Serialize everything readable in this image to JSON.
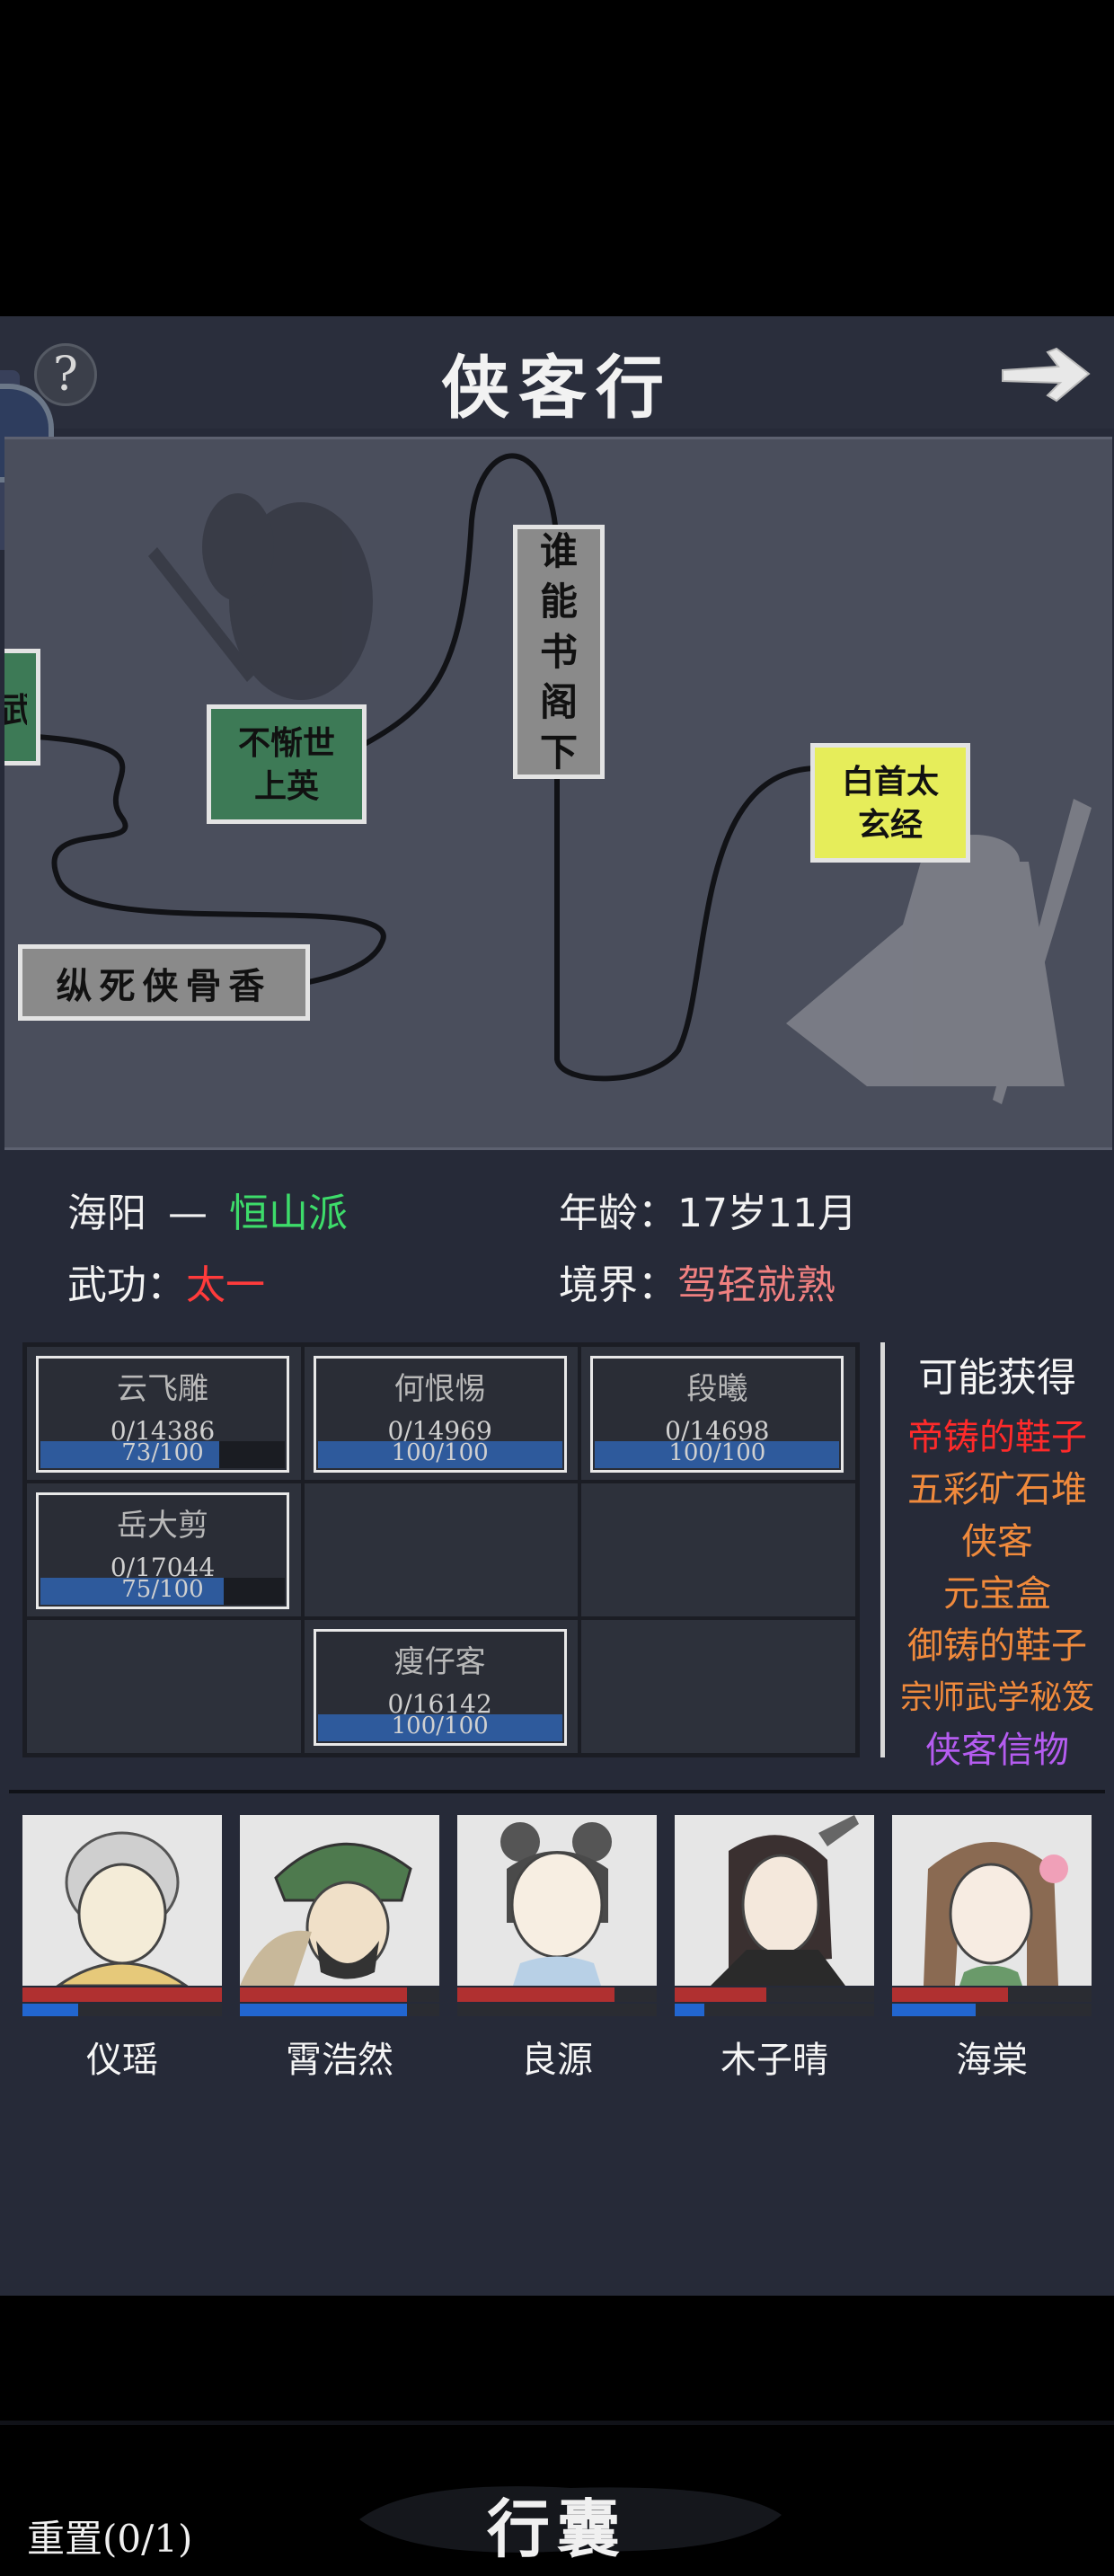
{
  "header": {
    "title": "侠客行"
  },
  "map": {
    "nodes": [
      {
        "id": "n0",
        "label": "武",
        "color": "#3d7a56"
      },
      {
        "id": "n1",
        "label": "不惭世上英",
        "color": "#3d7a56"
      },
      {
        "id": "n2",
        "label": "谁能书阁下",
        "color": "#8a8a8a"
      },
      {
        "id": "n3",
        "label": "白首太玄经",
        "color": "#e6ed5a"
      },
      {
        "id": "n4",
        "label": "纵死侠骨香",
        "color": "#8a8a8a"
      }
    ]
  },
  "info": {
    "name": "海阳",
    "dash": "—",
    "sect": "恒山派",
    "sect_color": "#3ddc6a",
    "age_label": "年龄：",
    "age_value": "17岁11月",
    "martial_label": "武功：",
    "martial_value": "太一",
    "martial_color": "#ff3b3b",
    "realm_label": "境界：",
    "realm_value": "驾轻就熟",
    "realm_color": "#f08080"
  },
  "enemies": [
    {
      "name": "云飞雕",
      "progress": "0/14386",
      "bar_text": "73/100",
      "bar_fill": 0.73
    },
    {
      "name": "何恨惕",
      "progress": "0/14969",
      "bar_text": "100/100",
      "bar_fill": 1.0
    },
    {
      "name": "段曦",
      "progress": "0/14698",
      "bar_text": "100/100",
      "bar_fill": 1.0
    },
    {
      "name": "岳大剪",
      "progress": "0/17044",
      "bar_text": "75/100",
      "bar_fill": 0.75
    },
    {
      "name": "瘦仔客",
      "progress": "0/16142",
      "bar_text": "100/100",
      "bar_fill": 1.0
    }
  ],
  "rewards": {
    "title": "可能获得",
    "items": [
      {
        "label": "帝铸的鞋子",
        "color": "#ff2a2a"
      },
      {
        "label": "五彩矿石堆",
        "color": "#f08a3c"
      },
      {
        "label": "侠客",
        "color": "#f08a3c"
      },
      {
        "label": "元宝盒",
        "color": "#f08a3c"
      },
      {
        "label": "御铸的鞋子",
        "color": "#f08a3c"
      },
      {
        "label": "宗师武学秘笈",
        "color": "#f08a3c"
      },
      {
        "label": "侠客信物",
        "color": "#b55cf0"
      }
    ]
  },
  "team": [
    {
      "name": "仪瑶",
      "hp": 1.0,
      "mp": 0.28
    },
    {
      "name": "霄浩然",
      "hp": 0.84,
      "mp": 0.84
    },
    {
      "name": "良源",
      "hp": 0.79,
      "mp": 0.0
    },
    {
      "name": "木子晴",
      "hp": 0.46,
      "mp": 0.15
    },
    {
      "name": "海棠",
      "hp": 0.58,
      "mp": 0.42
    }
  ],
  "footer": {
    "bag_label": "行囊",
    "reset_label": "重置(0/1)"
  }
}
